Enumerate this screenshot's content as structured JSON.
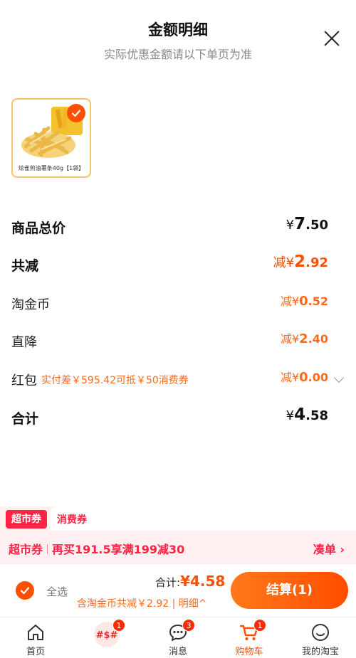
{
  "header": {
    "title": "金额明细",
    "subtitle": "实际优惠金额请以下单页为准"
  },
  "product": {
    "label": "炫雀煎油薯条40g【1袋】"
  },
  "rows": {
    "subtotal": {
      "label": "商品总价",
      "currency": "¥",
      "integer": "7",
      "decimal": ".50"
    },
    "discount_total": {
      "label": "共减",
      "prefix": "减¥",
      "integer": "2",
      "decimal": ".92"
    },
    "coins": {
      "label": "淘金币",
      "prefix": "减¥",
      "integer": "0",
      "decimal": ".52"
    },
    "direct": {
      "label": "直降",
      "prefix": "减¥",
      "integer": "2",
      "decimal": ".40"
    },
    "redpacket": {
      "label": "红包",
      "hint": "实付差￥595.42可抵￥50消费券",
      "prefix": "减¥",
      "integer": "0",
      "decimal": ".00"
    },
    "total": {
      "label": "合计",
      "currency": "¥",
      "integer": "4",
      "decimal": ".58"
    }
  },
  "coupon_tabs": [
    "超市券",
    "消费券"
  ],
  "promo": {
    "tag": "超市券",
    "text": "再买191.5享满199减30",
    "link": "凑单 ›"
  },
  "footer": {
    "select_all": "全选",
    "total_label": "合计:",
    "total_value": "¥4.58",
    "saved": "含淘金币共减￥2.92 | 明细^",
    "checkout": "结算(1)"
  },
  "tabbar": [
    {
      "label": "首页",
      "badge": ""
    },
    {
      "label": "",
      "badge": "1"
    },
    {
      "label": "消息",
      "badge": "3"
    },
    {
      "label": "购物车",
      "badge": "1"
    },
    {
      "label": "我的淘宝",
      "badge": ""
    }
  ],
  "colors": {
    "accent": "#ff5000",
    "promo_red": "#ff2244",
    "product_border": "#f5c36a"
  }
}
